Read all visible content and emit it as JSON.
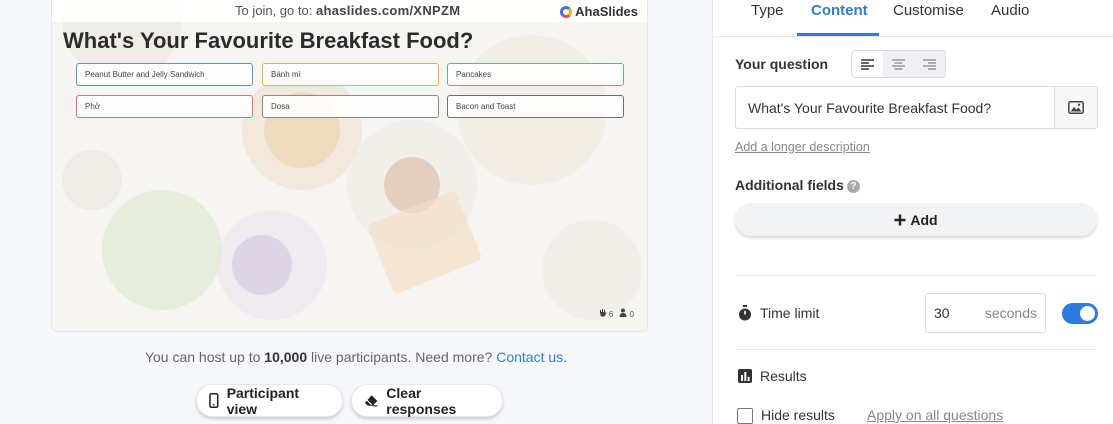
{
  "slide": {
    "join_prefix": "To join, go to:",
    "join_code": "ahaslides.com/XNPZM",
    "logo_text": "AhaSlides",
    "title": "What's Your Favourite Breakfast Food?",
    "options": [
      {
        "label": "Peanut Butter and Jelly Sandwich",
        "color": "#5b8fe0"
      },
      {
        "label": "Bánh mì",
        "color": "#f0b030"
      },
      {
        "label": "Pancakes",
        "color": "#4fbf7a"
      },
      {
        "label": "Phở",
        "color": "#f06080"
      },
      {
        "label": "Dosa",
        "color": "#8a8a8a"
      },
      {
        "label": "Bacon and Toast",
        "color": "#707070"
      }
    ],
    "responses_count": "6",
    "participants_count": "0"
  },
  "host_note": {
    "prefix": "You can host up to ",
    "number": "10,000",
    "middle": " live participants. Need more? ",
    "link": "Contact us",
    "suffix": "."
  },
  "actions": {
    "participant_view": "Participant view",
    "clear_responses": "Clear responses"
  },
  "panel": {
    "tabs": [
      "Type",
      "Content",
      "Customise",
      "Audio"
    ],
    "active_tab": "Content",
    "your_question_label": "Your question",
    "question_value": "What's Your Favourite Breakfast Food?",
    "longer_description_link": "Add a longer description",
    "additional_fields_label": "Additional fields",
    "add_button": "Add",
    "time_limit_label": "Time limit",
    "time_limit_value": "30",
    "time_limit_unit": "seconds",
    "time_limit_enabled": true,
    "results_label": "Results",
    "hide_results_label": "Hide results",
    "apply_all_link": "Apply on all questions"
  },
  "colors": {
    "accent": "#2e7be0"
  }
}
